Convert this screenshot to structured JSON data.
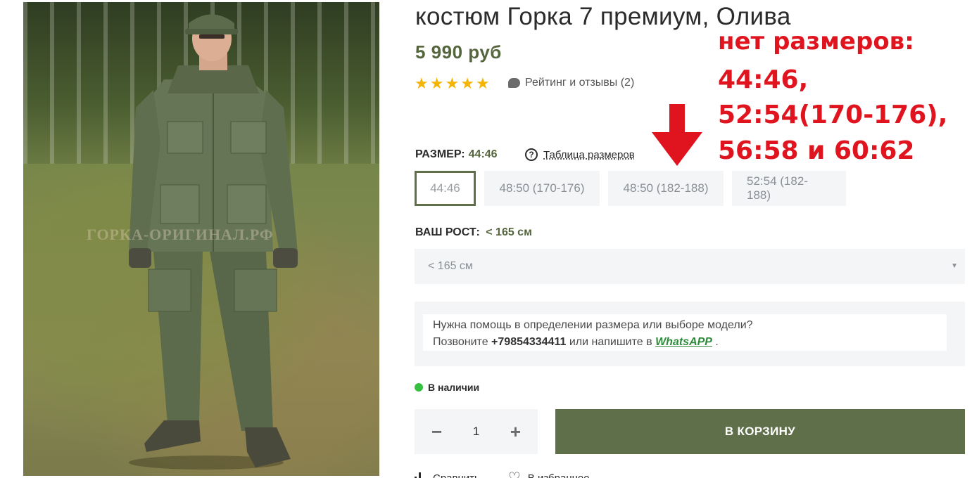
{
  "product": {
    "title": "костюм Горка 7 премиум, Олива",
    "price": "5 990 руб",
    "rating_stars": 5,
    "reviews_label": "Рейтинг и отзывы (2)",
    "watermark": "ГОРКА-ОРИГИНАЛ.РФ"
  },
  "annotation": {
    "line1": "нет размеров:",
    "line2": "44:46,",
    "line3": "52:54(170-176),",
    "line4": "56:58 и 60:62",
    "color": "#e0141e"
  },
  "size": {
    "label": "РАЗМЕР:",
    "selected": "44:46",
    "table_link": "Таблица размеров",
    "options": [
      "44:46",
      "48:50 (170-176)",
      "48:50 (182-188)",
      "52:54 (182-188)"
    ]
  },
  "height": {
    "label": "ВАШ РОСТ:",
    "selected": "< 165 см",
    "select_value": "< 165 см"
  },
  "help": {
    "line1": "Нужна помощь в определении размера или выборе модели?",
    "line2_prefix": "Позвоните",
    "phone": "+79854334411",
    "line2_mid": "или напишите в",
    "whatsapp": "WhatsAPP",
    "line2_end": "."
  },
  "stock": {
    "label": "В наличии",
    "color": "#35c13f"
  },
  "quantity": {
    "minus": "−",
    "value": "1",
    "plus": "+"
  },
  "cart": {
    "label": "В КОРЗИНУ",
    "color": "#5f6f4a"
  },
  "actions": {
    "compare": "Сравнить",
    "favorite": "В избранное"
  },
  "colors": {
    "accent": "#55663f",
    "star": "#f5b400"
  }
}
